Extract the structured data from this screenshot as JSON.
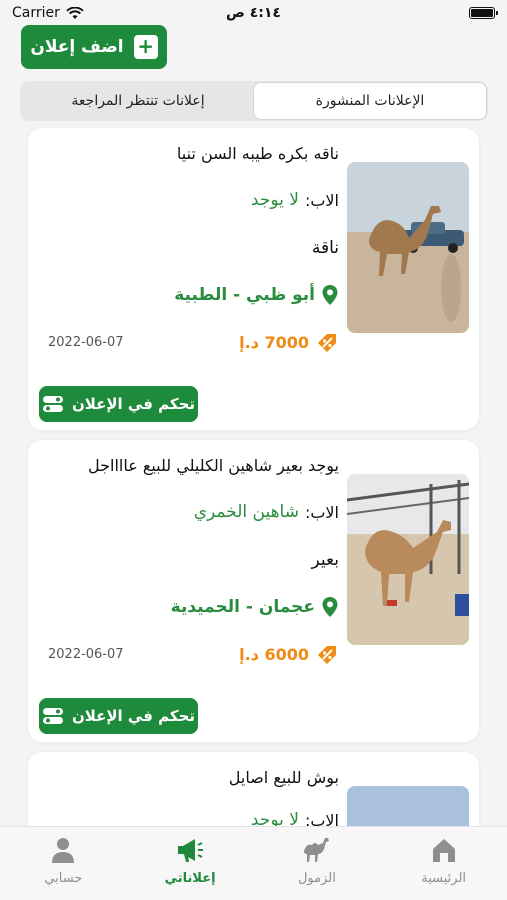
{
  "status_bar": {
    "carrier": "Carrier",
    "time": "٤:١٤ ص"
  },
  "header": {
    "add_ad_label": "اضف إعلان",
    "add_ad_icon": "plus-icon"
  },
  "tabs": [
    {
      "label": "إعلانات تنتظر المراجعة",
      "active": false
    },
    {
      "label": "الإعلانات المنشورة",
      "active": true
    }
  ],
  "ads": [
    {
      "title": "ناقه بكره طيبه السن تنيا",
      "father_label": "الاب:",
      "father_value": "لا يوجد",
      "type": "ناقة",
      "location": "أبو ظبي - الطبية",
      "price": "7000 د.إ",
      "date": "2022-06-07",
      "control_label": "تحكم في الإعلان"
    },
    {
      "title": "يوجد بعير شاهين الكليلي للبيع عااااجل",
      "father_label": "الاب:",
      "father_value": "شاهين الخمري",
      "type": "بعير",
      "location": "عجمان - الحميدية",
      "price": "6000 د.إ",
      "date": "2022-06-07",
      "control_label": "تحكم في الإعلان"
    },
    {
      "title": "بوش للبيع اصايل",
      "father_label": "الاب:",
      "father_value": "لا يوجد"
    }
  ],
  "bottom_nav": [
    {
      "label": "حسابي",
      "icon": "person-icon",
      "active": false
    },
    {
      "label": "إعلاناتي",
      "icon": "megaphone-icon",
      "active": true
    },
    {
      "label": "الزمول",
      "icon": "camel-icon",
      "active": false
    },
    {
      "label": "الرئيسية",
      "icon": "home-icon",
      "active": false
    }
  ],
  "colors": {
    "primary_green": "#1e8a3c",
    "price_orange": "#f08a12",
    "location_green": "#2a8c3e"
  }
}
